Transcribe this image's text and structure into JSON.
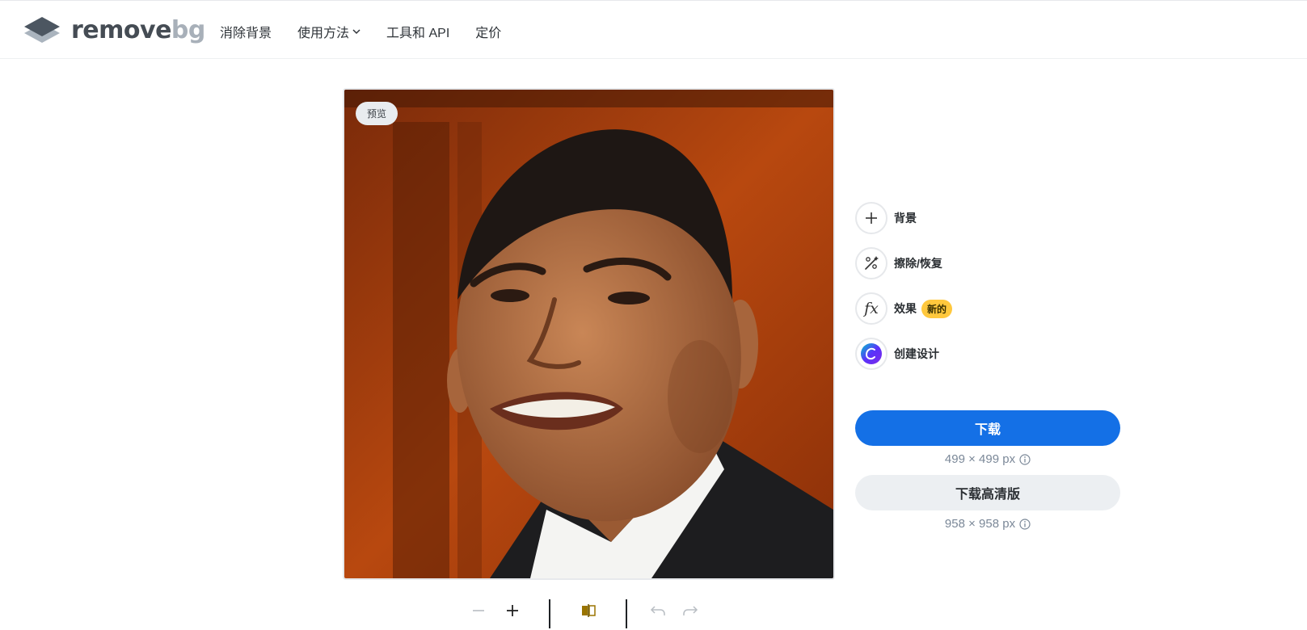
{
  "header": {
    "logo": {
      "word_main": "remove",
      "word_accent": "bg"
    },
    "nav": [
      {
        "label": "消除背景"
      },
      {
        "label": "使用方法"
      },
      {
        "label": "工具和 API"
      },
      {
        "label": "定价"
      }
    ]
  },
  "preview": {
    "badge": "预览"
  },
  "tools": [
    {
      "label": "背景",
      "icon": "plus-icon"
    },
    {
      "label": "擦除/恢复",
      "icon": "magic-brush-icon"
    },
    {
      "label": "效果",
      "icon": "fx-icon",
      "badge": "新的"
    },
    {
      "label": "创建设计",
      "icon": "canva-icon"
    }
  ],
  "download": {
    "primary_label": "下载",
    "primary_size": "499 × 499 px",
    "hd_label": "下载高清版",
    "hd_size": "958 × 958 px"
  },
  "colors": {
    "accent": "#1470e6",
    "badge_new": "#ffc83d",
    "secondary_button": "#eceff2"
  },
  "bottom_toolbar": [
    "zoom-out-icon",
    "zoom-in-icon",
    "compare-icon",
    "undo-icon",
    "redo-icon"
  ]
}
